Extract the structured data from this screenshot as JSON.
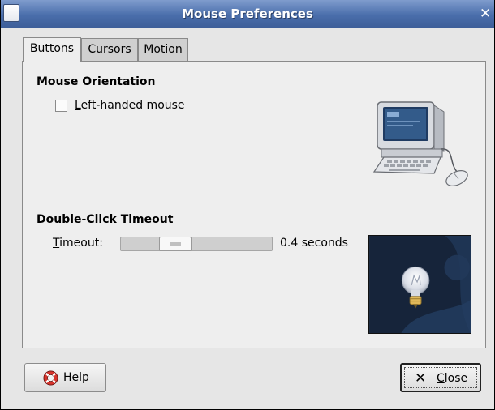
{
  "window": {
    "title": "Mouse Preferences"
  },
  "tabs": [
    {
      "label": "Buttons",
      "active": true
    },
    {
      "label": "Cursors",
      "active": false
    },
    {
      "label": "Motion",
      "active": false
    }
  ],
  "orientation": {
    "heading": "Mouse Orientation",
    "checkbox": {
      "mnemonic": "L",
      "rest": "eft-handed mouse",
      "checked": false
    }
  },
  "double_click": {
    "heading": "Double-Click Timeout",
    "timeout_label": {
      "mnemonic": "T",
      "rest": "imeout:"
    },
    "value": 0.4,
    "value_text": "0.4 seconds"
  },
  "buttons": {
    "help": {
      "mnemonic": "H",
      "rest": "elp"
    },
    "close": {
      "mnemonic": "C",
      "rest": "lose"
    }
  },
  "icons": {
    "window_menu": "window-menu-icon",
    "window_close": "window-close-icon",
    "computer": "computer-mouse-icon",
    "bulb": "lightbulb-icon",
    "help": "lifebuoy-icon",
    "close": "x-icon"
  },
  "colors": {
    "titlebar": "#4a6eab",
    "window_bg": "#e6e6e6",
    "bulb_bg": "#1a2a3f"
  }
}
